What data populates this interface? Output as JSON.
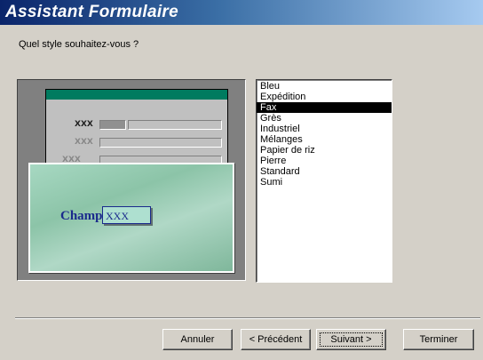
{
  "window": {
    "title": "Assistant Formulaire"
  },
  "prompt": "Quel style souhaitez-vous ?",
  "preview": {
    "label_xxx": "XXX",
    "field_label": "Champ",
    "field_value": "XXX"
  },
  "styles": {
    "items": [
      "Bleu",
      "Expédition",
      "Fax",
      "Grès",
      "Industriel",
      "Mélanges",
      "Papier de riz",
      "Pierre",
      "Standard",
      "Sumi"
    ],
    "selected": "Fax"
  },
  "buttons": {
    "cancel": "Annuler",
    "back": "< Précédent",
    "next": "Suivant >",
    "finish": "Terminer"
  },
  "colors": {
    "title_gradient_start": "#0a246a",
    "preview_header": "#007b5f",
    "selection": "#000000"
  }
}
